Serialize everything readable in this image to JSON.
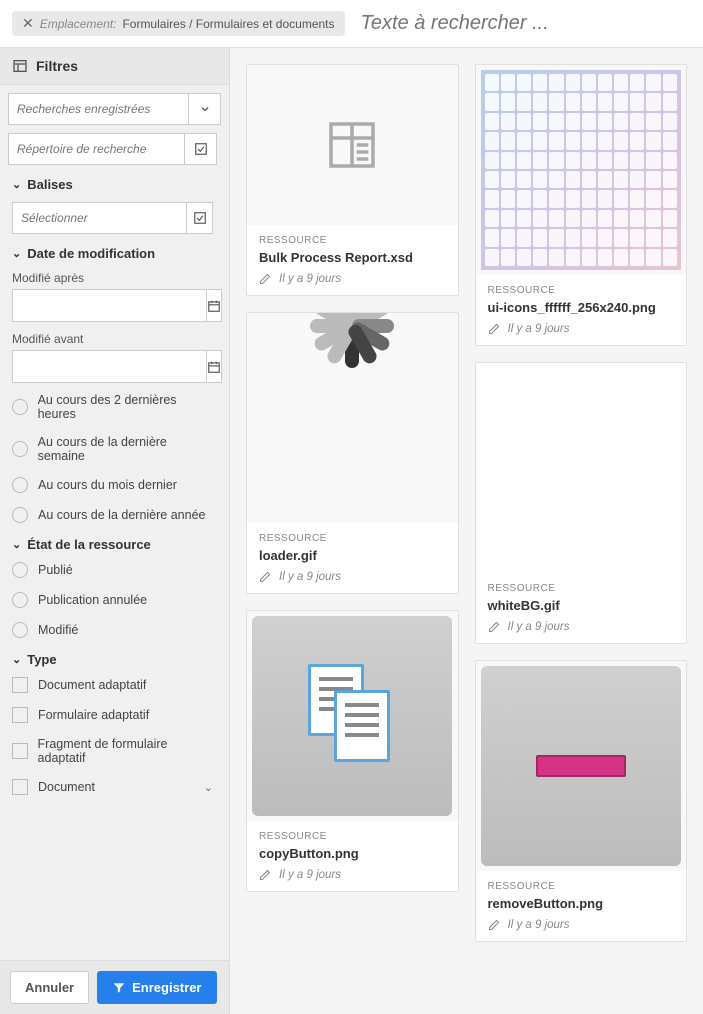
{
  "topbar": {
    "location_label": "Emplacement:",
    "location_path": "Formulaires / Formulaires et documents",
    "search_placeholder": "Texte à rechercher ..."
  },
  "sidebar": {
    "filters_title": "Filtres",
    "saved_searches_placeholder": "Recherches enregistrées",
    "search_dir_placeholder": "Répertoire de recherche",
    "sections": {
      "tags": {
        "title": "Balises",
        "select_placeholder": "Sélectionner"
      },
      "modified": {
        "title": "Date de modification",
        "after_label": "Modifié après",
        "before_label": "Modifié avant",
        "ranges": [
          "Au cours des 2 dernières heures",
          "Au cours de la dernière semaine",
          "Au cours du mois dernier",
          "Au cours de la dernière année"
        ]
      },
      "status": {
        "title": "État de la ressource",
        "options": [
          "Publié",
          "Publication annulée",
          "Modifié"
        ]
      },
      "type": {
        "title": "Type",
        "options": [
          "Document adaptatif",
          "Formulaire adaptatif",
          "Fragment de formulaire adaptatif",
          "Document"
        ]
      }
    },
    "footer": {
      "cancel": "Annuler",
      "save": "Enregistrer"
    }
  },
  "cards": {
    "type_label": "RESSOURCE",
    "meta_text": "Il y a 9 jours",
    "items": [
      {
        "title": "Bulk Process Report.xsd"
      },
      {
        "title": "loader.gif"
      },
      {
        "title": "copyButton.png"
      },
      {
        "title": "ui-icons_ffffff_256x240.png"
      },
      {
        "title": "whiteBG.gif"
      },
      {
        "title": "removeButton.png"
      }
    ]
  }
}
